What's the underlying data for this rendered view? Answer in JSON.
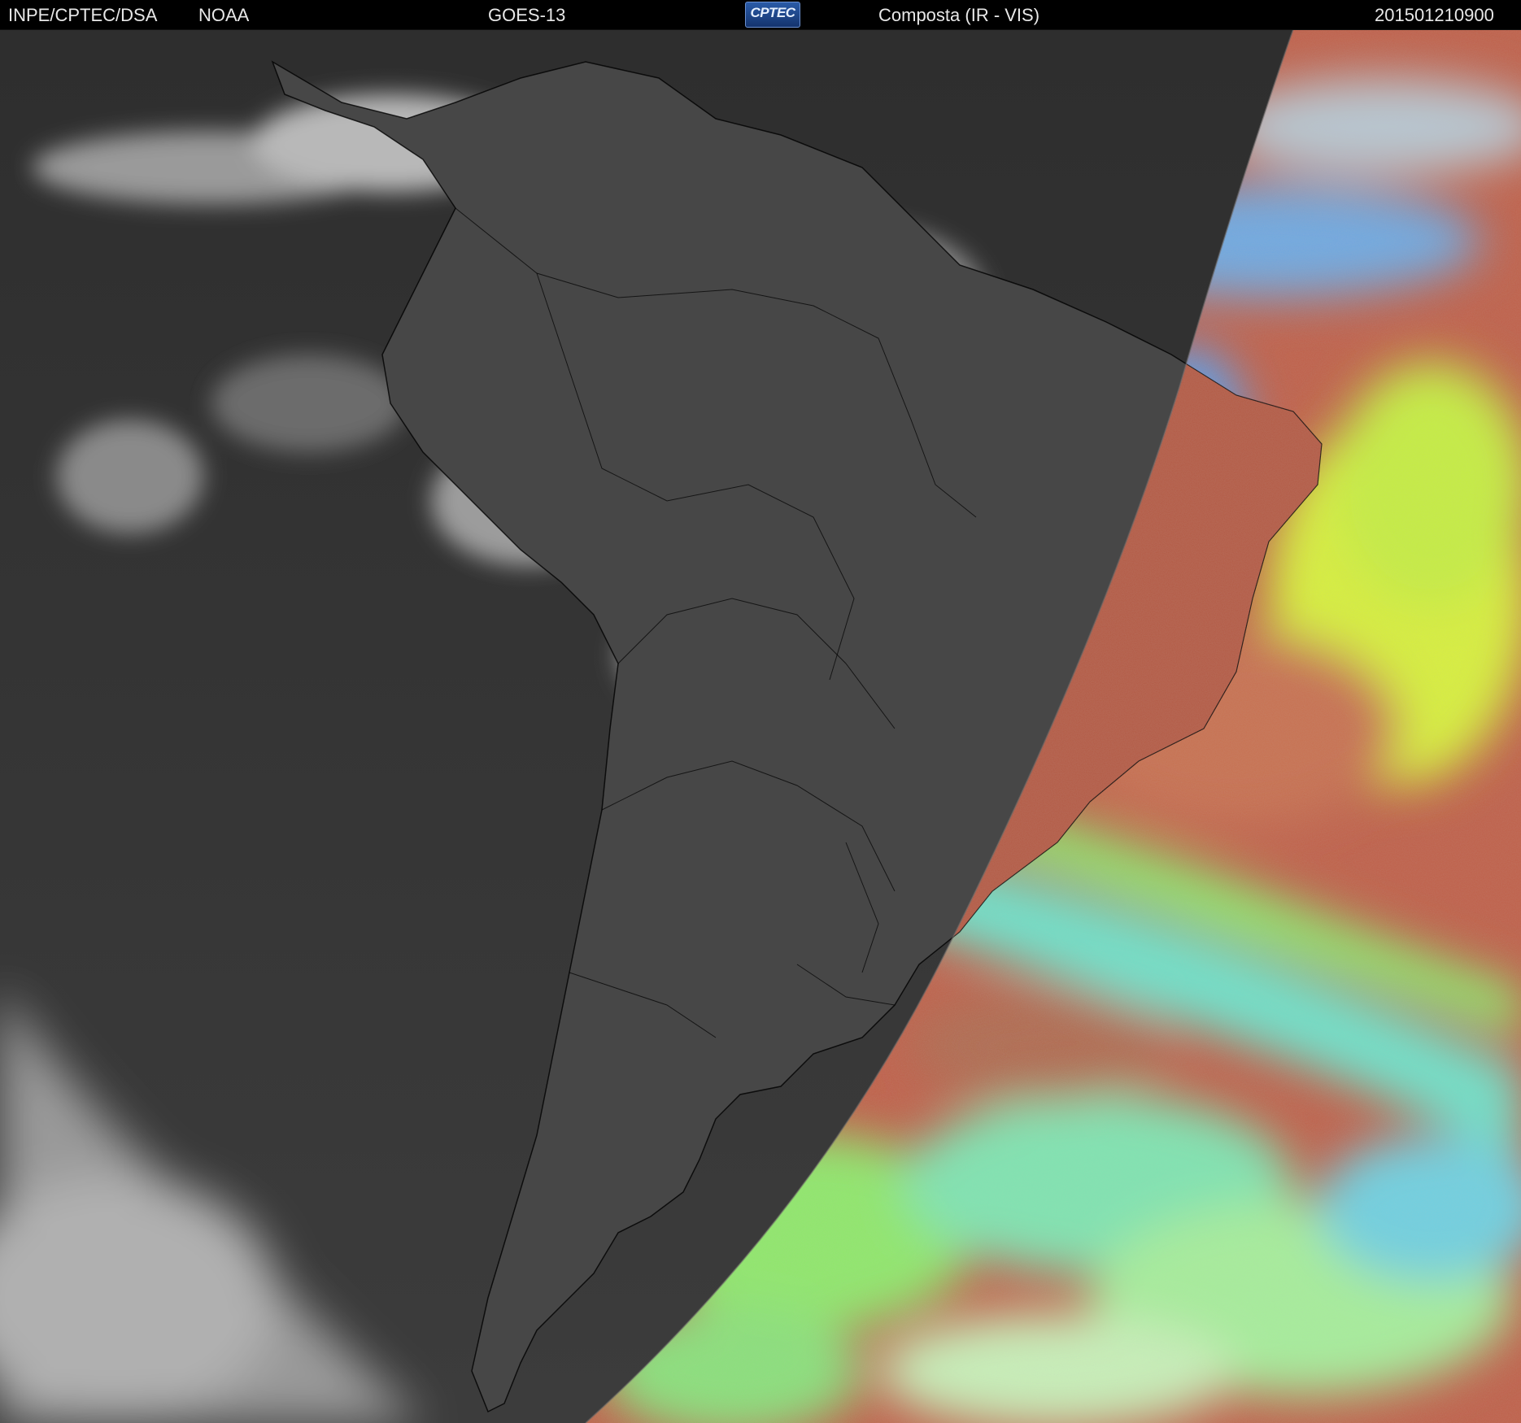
{
  "header": {
    "agency": "INPE/CPTEC/DSA",
    "partner": "NOAA",
    "satellite": "GOES-13",
    "logo_text": "CPTEC",
    "product": "Composta (IR - VIS)",
    "timestamp": "201501210900"
  },
  "colors": {
    "night_ocean": "#3a3a3a",
    "night_land": "#444444",
    "cloud_gray": "#d6d6d6",
    "day_ocean_red": "#c0624a",
    "day_cloud_cyan": "#6fe0c8",
    "day_cloud_green": "#8fe86a",
    "day_cloud_yellow": "#d8f03a",
    "day_cloud_blue": "#5a9ce8",
    "coastline": "#000000"
  }
}
